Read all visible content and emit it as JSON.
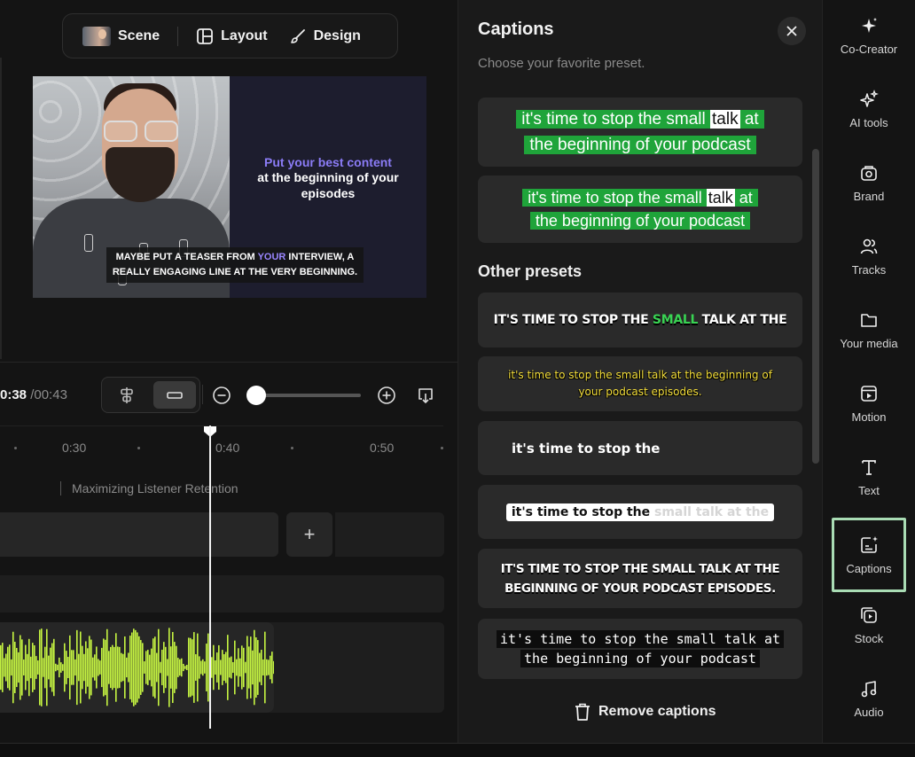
{
  "toolbar": {
    "tabs": [
      {
        "label": "Scene",
        "icon": "scene-thumbnail"
      },
      {
        "label": "Layout",
        "icon": "layout-icon"
      },
      {
        "label": "Design",
        "icon": "brush-icon"
      }
    ]
  },
  "preview": {
    "headline_accent": "Put your best content",
    "headline_rest": "at the beginning of your episodes",
    "caption_before": "MAYBE PUT A TEASER FROM ",
    "caption_highlight": "YOUR",
    "caption_after": " INTERVIEW, A REALLY ENGAGING LINE AT THE VERY BEGINNING."
  },
  "timeline": {
    "current_time": "0:38",
    "total_time": "/00:43",
    "ticks": [
      "0:30",
      "0:40",
      "0:50"
    ],
    "chapter_title": "Maximizing Listener Retention",
    "add_label": "+",
    "zoom_level": 0.0,
    "waveform_color": "#c6f542"
  },
  "captions_panel": {
    "title": "Captions",
    "subtitle": "Choose your favorite preset.",
    "favorites": [
      {
        "line1_before": "it's time to stop the small ",
        "line1_highlight": "talk",
        "line1_after": " at",
        "line2": "the beginning of your podcast"
      },
      {
        "line1_before": "it's time to stop the small ",
        "line1_highlight": "talk",
        "line1_after": " at",
        "line2": "the beginning of your podcast"
      }
    ],
    "other_heading": "Other presets",
    "presets": {
      "bold_upper_before": "IT'S TIME TO STOP THE ",
      "bold_upper_highlight": "SMALL",
      "bold_upper_after": " TALK AT THE",
      "yellow_text": "it's time to stop the small talk at the beginning of your podcast episodes.",
      "plain_text": "it's time to stop the",
      "boxed_visible": "it's time to stop the",
      "boxed_faded": " small talk at the",
      "upper_two_line": "IT'S TIME TO STOP THE SMALL TALK AT THE BEGINNING OF YOUR PODCAST EPISODES.",
      "mono_line1": "it's time to stop the small talk at",
      "mono_line2": "the beginning of your podcast"
    },
    "remove_label": "Remove captions",
    "accent_green": "#1fa43a"
  },
  "rail": {
    "items": [
      {
        "label": "Co-Creator",
        "icon": "sparkle-icon"
      },
      {
        "label": "AI tools",
        "icon": "ai-sparkles-icon"
      },
      {
        "label": "Brand",
        "icon": "brand-icon"
      },
      {
        "label": "Tracks",
        "icon": "users-icon"
      },
      {
        "label": "Your media",
        "icon": "folder-icon"
      },
      {
        "label": "Motion",
        "icon": "motion-icon"
      },
      {
        "label": "Text",
        "icon": "text-icon"
      },
      {
        "label": "Captions",
        "icon": "captions-icon"
      },
      {
        "label": "Stock",
        "icon": "stock-icon"
      },
      {
        "label": "Audio",
        "icon": "music-icon"
      }
    ],
    "active": "Captions",
    "active_color": "#a9dcb4"
  }
}
